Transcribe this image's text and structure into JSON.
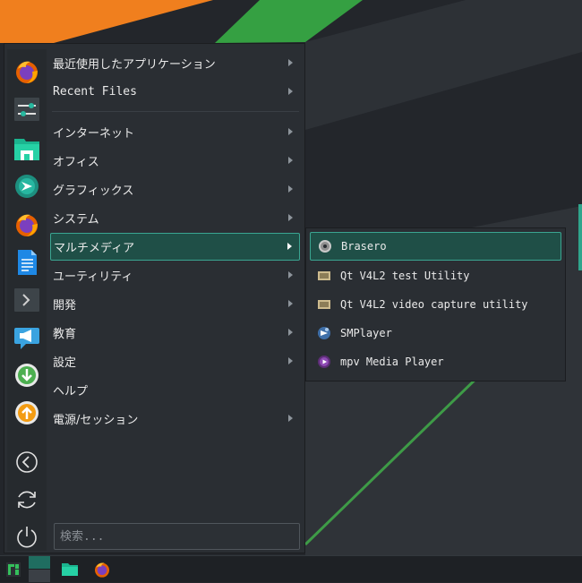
{
  "favorites": [
    {
      "name": "firefox-icon"
    },
    {
      "name": "system-settings-icon"
    },
    {
      "name": "file-manager-icon"
    },
    {
      "name": "browser-icon"
    },
    {
      "name": "firefox-icon"
    },
    {
      "name": "text-document-icon"
    },
    {
      "name": "terminal-icon"
    },
    {
      "name": "announcement-icon"
    },
    {
      "name": "download-icon"
    },
    {
      "name": "upload-icon"
    }
  ],
  "categories": [
    {
      "label": "最近使用したアプリケーション",
      "submenu": true
    },
    {
      "label": "Recent Files",
      "submenu": true
    },
    {
      "label": "インターネット",
      "submenu": true
    },
    {
      "label": "オフィス",
      "submenu": true
    },
    {
      "label": "グラフィックス",
      "submenu": true
    },
    {
      "label": "システム",
      "submenu": true
    },
    {
      "label": "マルチメディア",
      "submenu": true,
      "active": true
    },
    {
      "label": "ユーティリティ",
      "submenu": true
    },
    {
      "label": "開発",
      "submenu": true
    },
    {
      "label": "教育",
      "submenu": true
    },
    {
      "label": "設定",
      "submenu": true
    },
    {
      "label": "ヘルプ",
      "submenu": false
    },
    {
      "label": "電源/セッション",
      "submenu": true
    }
  ],
  "search": {
    "placeholder": "検索..."
  },
  "multimedia": [
    {
      "label": "Brasero",
      "icon": "disc-icon",
      "active": true
    },
    {
      "label": "Qt V4L2 test Utility",
      "icon": "video-device-icon"
    },
    {
      "label": "Qt V4L2 video capture utility",
      "icon": "video-device-icon"
    },
    {
      "label": "SMPlayer",
      "icon": "smplayer-icon"
    },
    {
      "label": "mpv Media Player",
      "icon": "mpv-icon"
    }
  ],
  "colors": {
    "accent": "#3aa591",
    "highlight": "#1f4f47",
    "wallpaper_orange": "#f07f1e",
    "wallpaper_green": "#35a042"
  }
}
